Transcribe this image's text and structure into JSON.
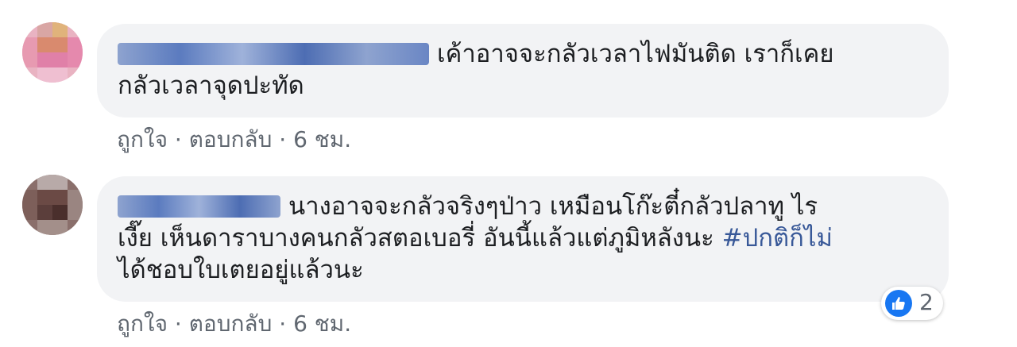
{
  "comments": [
    {
      "text_line1": "เค้าอาจจะกลัวเวลาไฟมันติด เราก็เคย",
      "text_line2": "กลัวเวลาจุดปะทัด",
      "actions": {
        "like": "ถูกใจ",
        "sep1": " · ",
        "reply": "ตอบกลับ",
        "sep2": " · ",
        "time": "6 ชม."
      }
    },
    {
      "text_line1": "นางอาจจะกลัวจริงๆป่าว เหมือนโก๊ะตี๋กลัวปลาทู ไร",
      "text_line2": "เงี๊ย เห็นดาราบางคนกลัวสตอเบอรี่ อันนี้แล้วแต่ภูมิหลังนะ ",
      "hashtag": "#ปกติก็ไม่",
      "text_line3": "ได้ชอบใบเตยอยู่แล้วนะ",
      "reaction": {
        "icon": "like-icon",
        "count": "2",
        "color": "#1877f2"
      },
      "actions": {
        "like": "ถูกใจ",
        "sep1": " · ",
        "reply": "ตอบกลับ",
        "sep2": " · ",
        "time": "6 ชม."
      }
    }
  ],
  "colors": {
    "bubble": "#f2f3f5",
    "meta_text": "#606770",
    "hashtag": "#385898",
    "name_blur": "#5b7bbf"
  }
}
